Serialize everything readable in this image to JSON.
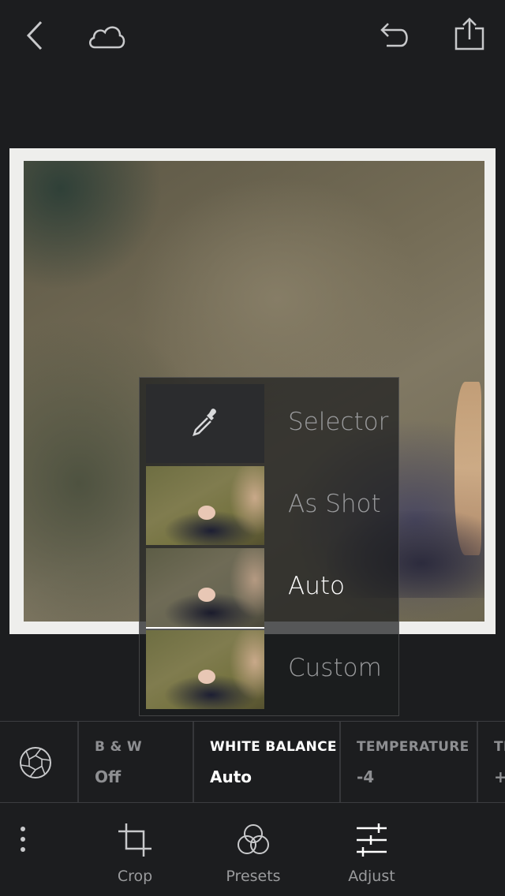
{
  "top_bar": {
    "back_icon": "chevron-left-icon",
    "cloud_icon": "cloud-icon",
    "undo_icon": "undo-icon",
    "share_icon": "share-icon"
  },
  "white_balance_menu": {
    "options": [
      {
        "label": "Selector",
        "icon": "eyedropper-icon"
      },
      {
        "label": "As Shot"
      },
      {
        "label": "Auto",
        "selected": true
      },
      {
        "label": "Custom"
      }
    ]
  },
  "tool_strip": {
    "aperture_icon": "aperture-icon",
    "items": [
      {
        "name": "B & W",
        "value": "Off"
      },
      {
        "name": "WHITE BALANCE",
        "value": "Auto",
        "active": true
      },
      {
        "name": "TEMPERATURE",
        "value": "-4"
      },
      {
        "name": "TI",
        "value": "+"
      }
    ]
  },
  "bottom_bar": {
    "more_icon": "more-vertical-icon",
    "crop_label": "Crop",
    "presets_label": "Presets",
    "adjust_label": "Adjust"
  },
  "colors": {
    "background": "#1c1d1f",
    "active_text": "#ffffff",
    "inactive_text": "#8e8f92"
  }
}
